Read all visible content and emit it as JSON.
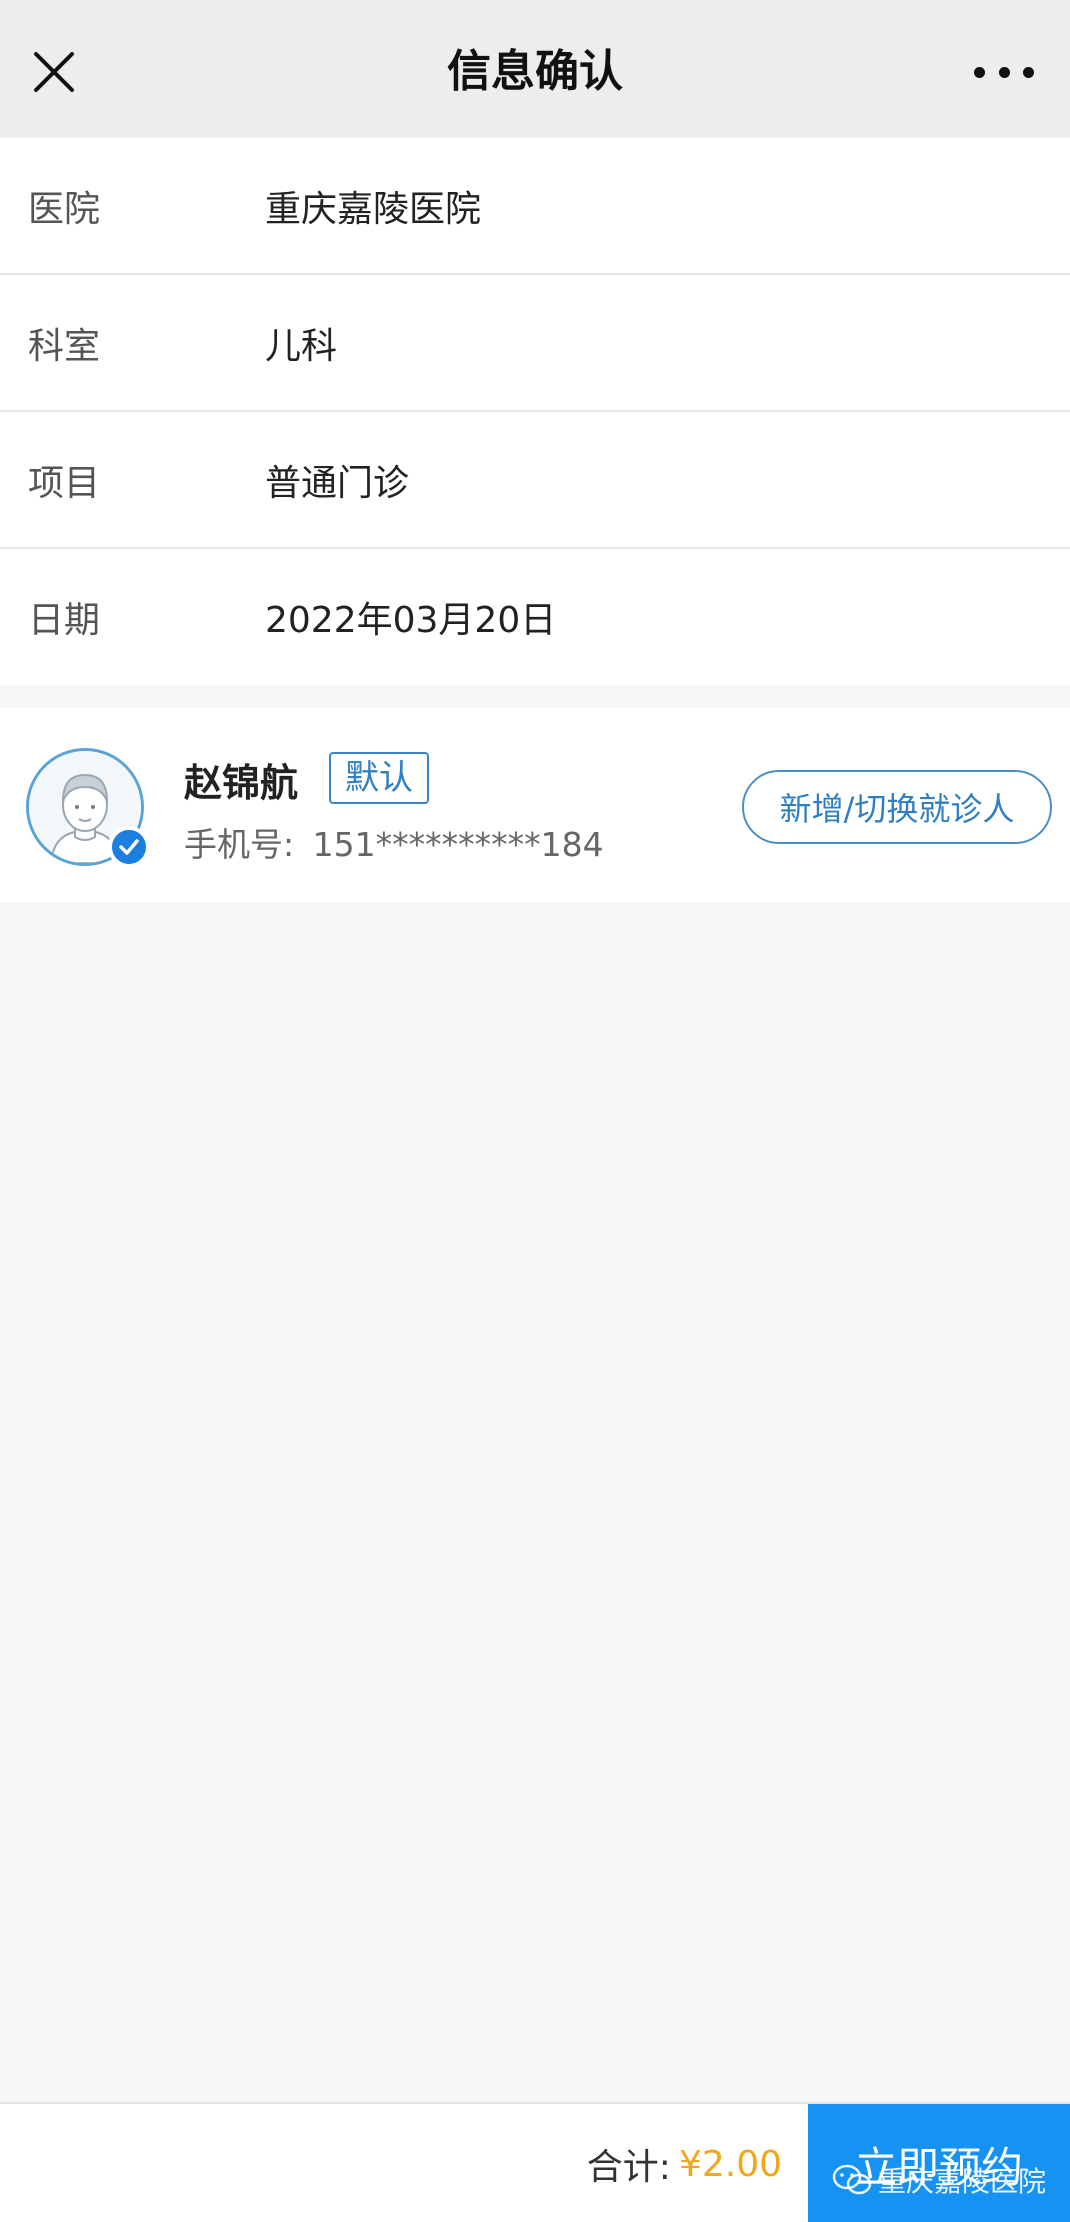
{
  "header": {
    "title": "信息确认"
  },
  "info_rows": [
    {
      "label": "医院",
      "value": "重庆嘉陵医院"
    },
    {
      "label": "科室",
      "value": "儿科"
    },
    {
      "label": "项目",
      "value": "普通门诊"
    },
    {
      "label": "日期",
      "value": "2022年03月20日"
    }
  ],
  "patient": {
    "name": "赵锦航",
    "badge": "默认",
    "phone_label": "手机号:",
    "phone_value": "151**********184",
    "switch_label": "新增/切换就诊人"
  },
  "footer": {
    "total_label": "合计:",
    "total_amount": "¥2.00",
    "book_label": "立即预约",
    "watermark": "重庆嘉陵医院"
  },
  "colors": {
    "accent": "#1592f2",
    "price": "#f0a81a",
    "badge": "#2f7fc1"
  }
}
